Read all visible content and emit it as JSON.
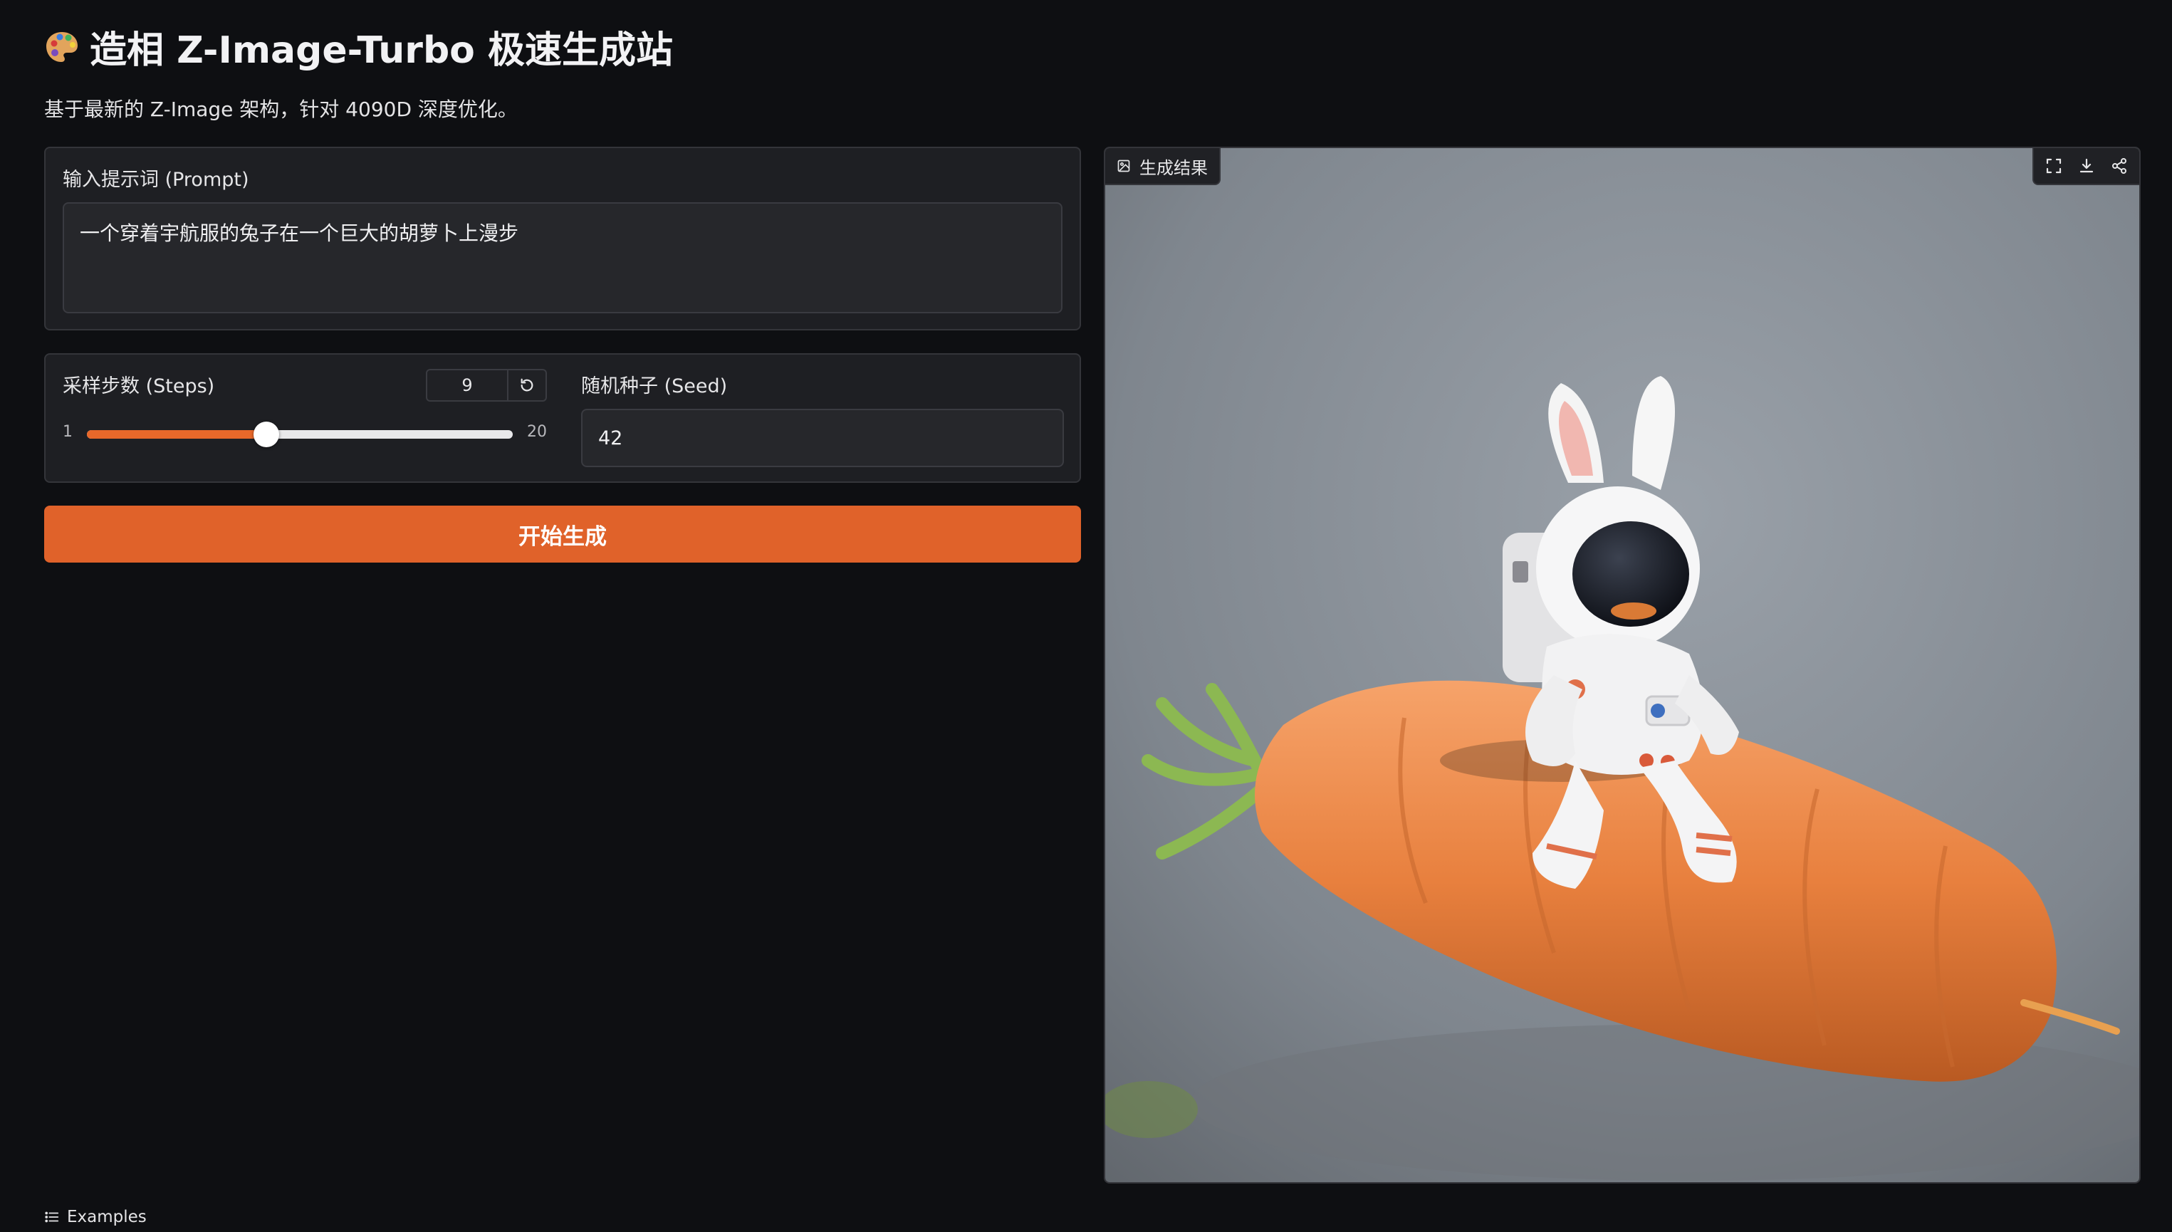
{
  "header": {
    "title": "造相 Z-Image-Turbo 极速生成站",
    "subtitle": "基于最新的 Z-Image 架构，针对 4090D 深度优化。",
    "icon": "palette-icon"
  },
  "prompt": {
    "label": "输入提示词 (Prompt)",
    "value": "一个穿着宇航服的兔子在一个巨大的胡萝卜上漫步"
  },
  "steps": {
    "label": "采样步数 (Steps)",
    "value": "9",
    "min": "1",
    "max": "20",
    "fraction": 0.421
  },
  "seed": {
    "label": "随机种子 (Seed)",
    "value": "42"
  },
  "actions": {
    "generate_label": "开始生成"
  },
  "output": {
    "label": "生成结果",
    "tools": [
      "fullscreen-icon",
      "download-icon",
      "share-icon"
    ],
    "image_alt": "A white astronaut rabbit figurine walking on a giant carrot against a grey backdrop"
  },
  "footer": {
    "examples_label": "Examples"
  },
  "colors": {
    "accent": "#e0622a",
    "background": "#0e0f12",
    "panel": "#1e1f23"
  }
}
